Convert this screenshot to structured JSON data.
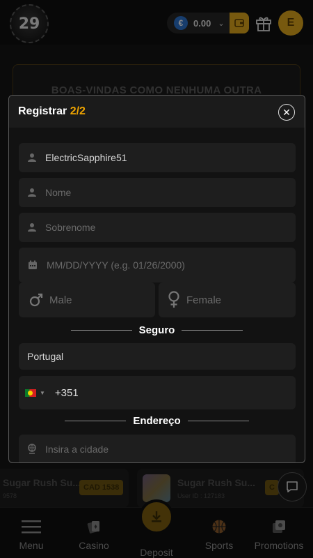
{
  "header": {
    "logo_text": "29",
    "balance": "0.00",
    "currency_symbol": "€",
    "avatar_initial": "E"
  },
  "banner": {
    "title": "BOAS-VINDAS COMO NENHUMA OUTRA"
  },
  "cards": [
    {
      "name": "Sugar Rush Su...",
      "sub": "9578",
      "badge": "CAD 1538"
    },
    {
      "name": "Sugar Rush Su...",
      "sub": "User ID : 127183",
      "badge": "C"
    }
  ],
  "bottom_nav": {
    "items": [
      {
        "label": "Menu",
        "icon": "hamburger-icon"
      },
      {
        "label": "Casino",
        "icon": "cards-icon"
      },
      {
        "label": "Deposit",
        "icon": "download-icon"
      },
      {
        "label": "Sports",
        "icon": "basketball-icon"
      },
      {
        "label": "Promotions",
        "icon": "gift-card-icon"
      }
    ]
  },
  "modal": {
    "title": "Registrar",
    "step": "2/2",
    "username_value": "ElectricSapphire51",
    "first_name_placeholder": "Nome",
    "last_name_placeholder": "Sobrenome",
    "dob_placeholder": "MM/DD/YYYY (e.g. 01/26/2000)",
    "gender_male": "Male",
    "gender_female": "Female",
    "section_security": "Seguro",
    "country_value": "Portugal",
    "phone_code": "+351",
    "section_address": "Endereço",
    "city_placeholder": "Insira a cidade"
  },
  "colors": {
    "accent": "#f0a500",
    "gold": "#d9a21c",
    "field_bg": "#1e1e1e"
  }
}
